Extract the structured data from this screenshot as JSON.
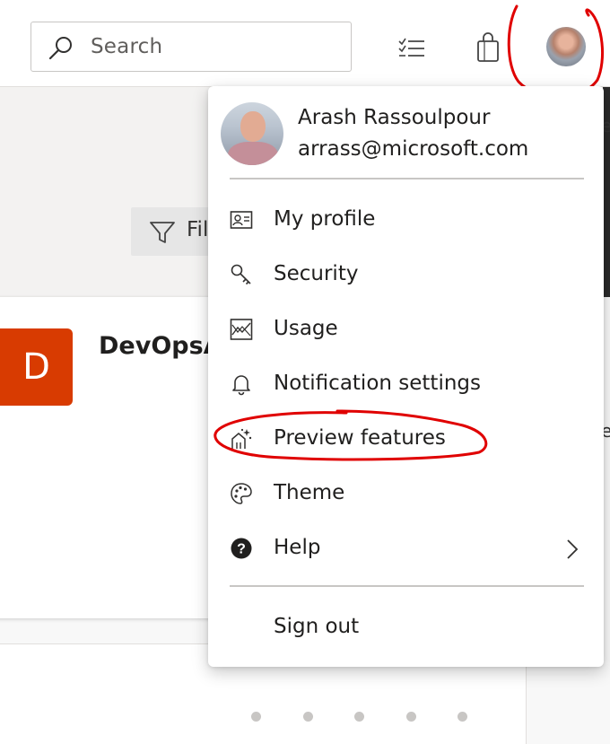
{
  "header": {
    "search_placeholder": "Search",
    "icons": [
      "search-icon",
      "task-list-icon",
      "shopping-bag-icon",
      "user-avatar"
    ]
  },
  "background": {
    "filter_label": "Fil",
    "project_initial": "D",
    "project_name": "DevOpsA",
    "right_edge_glyph_1": "e",
    "right_edge_glyph_2": "e",
    "project_tile_color": "#d83b01"
  },
  "user_menu": {
    "name": "Arash Rassoulpour",
    "email": "arrass@microsoft.com",
    "items": [
      {
        "label": "My profile",
        "icon": "profile-card-icon"
      },
      {
        "label": "Security",
        "icon": "key-icon"
      },
      {
        "label": "Usage",
        "icon": "usage-chart-icon"
      },
      {
        "label": "Notification settings",
        "icon": "bell-icon"
      },
      {
        "label": "Preview features",
        "icon": "preview-features-icon"
      },
      {
        "label": "Theme",
        "icon": "palette-icon"
      },
      {
        "label": "Help",
        "icon": "help-circle-icon"
      }
    ],
    "sign_out": "Sign out"
  },
  "annotations": {
    "color": "#e00000",
    "highlighted": [
      "user-avatar",
      "Preview features"
    ]
  }
}
